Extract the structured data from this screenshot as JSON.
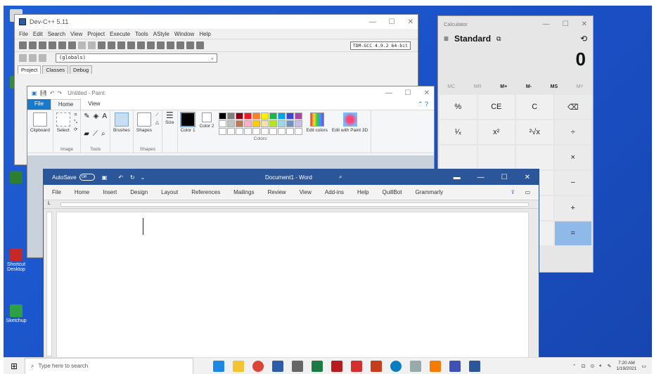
{
  "devcpp": {
    "title": "Dev-C++ 5.11",
    "menu": [
      "File",
      "Edit",
      "Search",
      "View",
      "Project",
      "Execute",
      "Tools",
      "AStyle",
      "Window",
      "Help"
    ],
    "compiler": "TDM-GCC 4.9.2 64-bit",
    "globals": "(globals)",
    "tabs": [
      "Project",
      "Classes",
      "Debug"
    ]
  },
  "paint": {
    "title": "Untitled - Paint",
    "tabs": [
      "File",
      "Home",
      "View"
    ],
    "groups": {
      "clipboard": "Clipboard",
      "select": "Select",
      "image": "Image",
      "tools": "Tools",
      "brushes": "Brushes",
      "shapes": "Shapes",
      "shapes_group": "Shapes",
      "size": "Size",
      "color1": "Color 1",
      "color2": "Color 2",
      "colors": "Colors",
      "edit_colors": "Edit colors",
      "edit_paint3d": "Edit with Paint 3D"
    },
    "swatches": [
      "#000000",
      "#7f7f7f",
      "#880015",
      "#ed1c24",
      "#ff7f27",
      "#fff200",
      "#22b14c",
      "#00a2e8",
      "#3f48cc",
      "#a349a4",
      "#ffffff",
      "#c3c3c3",
      "#b97a57",
      "#ffaec9",
      "#ffc90e",
      "#efe4b0",
      "#b5e61d",
      "#99d9ea",
      "#7092be",
      "#c8bfe7",
      "#ffffff",
      "#ffffff",
      "#ffffff",
      "#ffffff",
      "#ffffff",
      "#ffffff",
      "#ffffff",
      "#ffffff",
      "#ffffff",
      "#ffffff"
    ]
  },
  "calc": {
    "title": "Calculator",
    "mode": "Standard",
    "display": "0",
    "memory": [
      "MC",
      "MR",
      "M+",
      "M-",
      "MS",
      "M˅"
    ],
    "keys": [
      "%",
      "CE",
      "C",
      "⌫",
      "¹⁄ₓ",
      "x²",
      "²√x",
      "÷",
      "",
      "",
      "",
      "×",
      "",
      "",
      "",
      "−",
      "",
      "",
      "",
      "+",
      "",
      "",
      "",
      "="
    ]
  },
  "word": {
    "autosave": "AutoSave",
    "toggle": "Off",
    "title": "Document1 - Word",
    "menu": [
      "File",
      "Home",
      "Insert",
      "Design",
      "Layout",
      "References",
      "Mailings",
      "Review",
      "View",
      "Add-ins",
      "Help",
      "QuillBot",
      "Grammarly"
    ]
  },
  "taskbar": {
    "search_placeholder": "Type here to search",
    "time": "7:20 AM",
    "date": "1/19/2021"
  },
  "desktop": {
    "icons": [
      "",
      "",
      "",
      "Shortcut Desktop",
      "Sketchup"
    ]
  }
}
